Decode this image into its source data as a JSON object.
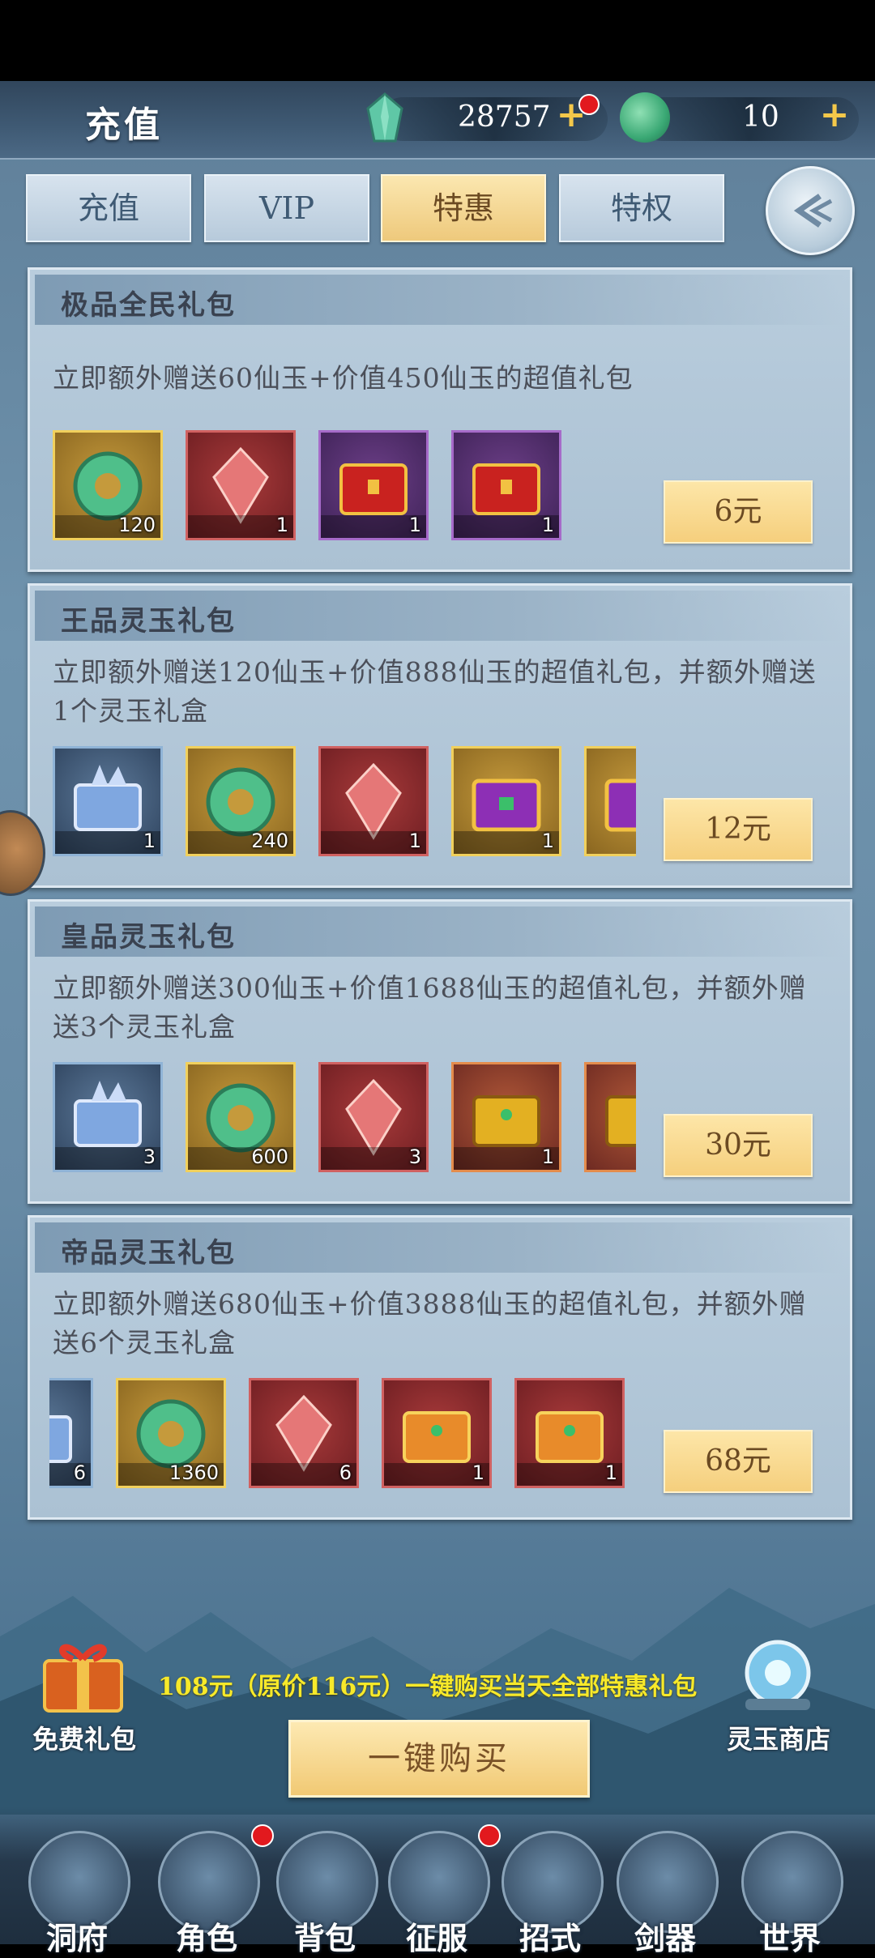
{
  "header": {
    "title": "充值",
    "gems": "28757",
    "jade": "10",
    "plus_symbol": "+"
  },
  "tabs": [
    {
      "label": "充值",
      "active": false
    },
    {
      "label": "VIP",
      "active": false
    },
    {
      "label": "特惠",
      "active": true
    },
    {
      "label": "特权",
      "active": false
    }
  ],
  "packs": [
    {
      "title": "极品全民礼包",
      "desc": "立即额外赠送60仙玉+价值450仙玉的超值礼包",
      "price": "6元",
      "items": [
        {
          "icon": "jade-icon",
          "count": "120"
        },
        {
          "icon": "red-crystal-icon",
          "count": "1"
        },
        {
          "icon": "red-chest-icon",
          "count": "1"
        },
        {
          "icon": "red-chest-icon",
          "count": "1"
        }
      ]
    },
    {
      "title": "王品灵玉礼包",
      "desc": "立即额外赠送120仙玉+价值888仙玉的超值礼包，并额外赠送1个灵玉礼盒",
      "price": "12元",
      "items": [
        {
          "icon": "crystal-chest-icon",
          "count": "1"
        },
        {
          "icon": "jade-icon",
          "count": "240"
        },
        {
          "icon": "red-crystal-icon",
          "count": "1"
        },
        {
          "icon": "purple-chest-icon",
          "count": "1"
        }
      ]
    },
    {
      "title": "皇品灵玉礼包",
      "desc": "立即额外赠送300仙玉+价值1688仙玉的超值礼包，并额外赠送3个灵玉礼盒",
      "price": "30元",
      "items": [
        {
          "icon": "crystal-chest-icon",
          "count": "3"
        },
        {
          "icon": "jade-icon",
          "count": "600"
        },
        {
          "icon": "red-crystal-icon",
          "count": "3"
        },
        {
          "icon": "gold-chest-icon",
          "count": "1"
        }
      ]
    },
    {
      "title": "帝品灵玉礼包",
      "desc": "立即额外赠送680仙玉+价值3888仙玉的超值礼包，并额外赠送6个灵玉礼盒",
      "price": "68元",
      "items": [
        {
          "icon": "crystal-chest-icon",
          "count": "6"
        },
        {
          "icon": "jade-icon",
          "count": "1360"
        },
        {
          "icon": "red-crystal-icon",
          "count": "6"
        },
        {
          "icon": "orange-chest-icon",
          "count": "1"
        },
        {
          "icon": "orange-chest-icon",
          "count": "1"
        }
      ]
    }
  ],
  "bottom": {
    "offer_text": "108元（原价116元）一键购买当天全部特惠礼包",
    "buy_all_label": "一键购买",
    "free_gift_label": "免费礼包",
    "shop_label": "灵玉商店"
  },
  "nav": [
    {
      "label": "洞府",
      "dot": false
    },
    {
      "label": "角色",
      "dot": true
    },
    {
      "label": "背包",
      "dot": false
    },
    {
      "label": "征服",
      "dot": true
    },
    {
      "label": "招式",
      "dot": false
    },
    {
      "label": "剑器",
      "dot": false
    },
    {
      "label": "世界",
      "dot": false
    }
  ],
  "colors": {
    "accent_gold": "#f5cf7d",
    "offer_yellow": "#f7e92a",
    "notification_red": "#e2191e"
  }
}
